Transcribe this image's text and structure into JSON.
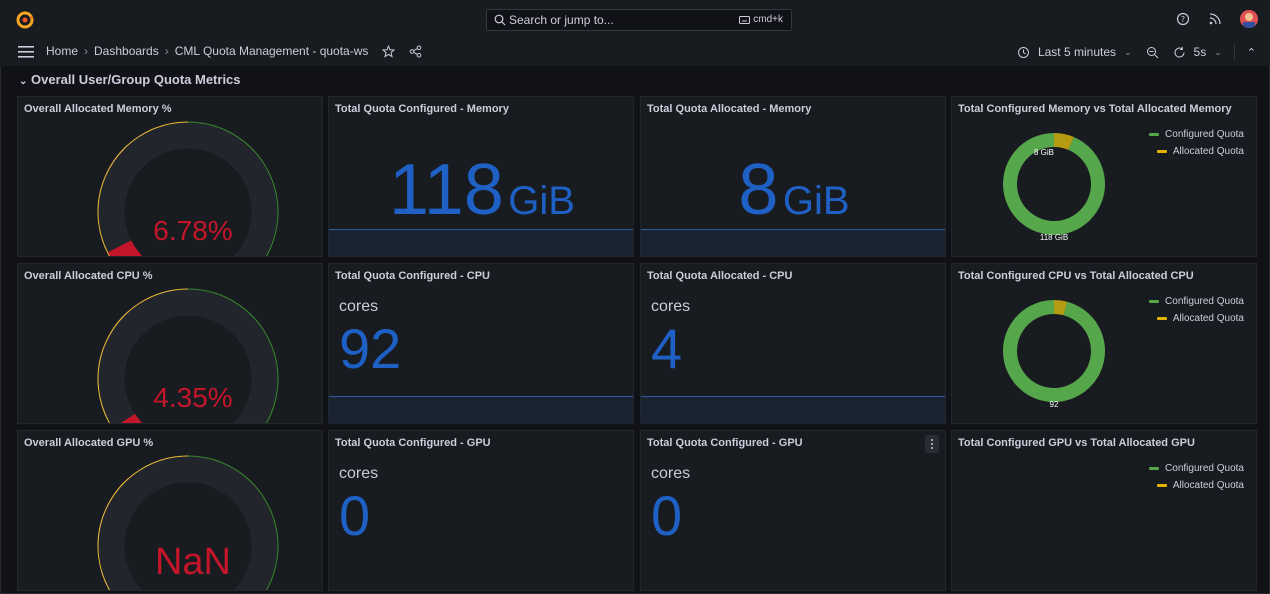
{
  "topbar": {
    "search_placeholder": "Search or jump to...",
    "shortcut": "cmd+k"
  },
  "breadcrumb": {
    "home": "Home",
    "dashboards": "Dashboards",
    "current": "CML Quota Management - quota-ws"
  },
  "time": {
    "range": "Last 5 minutes",
    "refresh": "5s"
  },
  "row": {
    "title": "Overall User/Group Quota Metrics"
  },
  "colors": {
    "gauge_red": "#c4162a",
    "gauge_yellow": "#eab839",
    "gauge_green": "#37872d",
    "stat_blue": "#1f60c4",
    "pie_green": "#56a64b",
    "pie_yellow": "#b59b12"
  },
  "gauges": [
    {
      "title": "Overall Allocated Memory %",
      "value_text": "6.78%",
      "fraction": 0.0678
    },
    {
      "title": "Overall Allocated CPU %",
      "value_text": "4.35%",
      "fraction": 0.0435
    },
    {
      "title": "Overall Allocated GPU %",
      "value_text": "NaN",
      "fraction": 0
    }
  ],
  "stats": [
    {
      "title": "Total Quota Configured - Memory",
      "value": "118",
      "unit": "GiB"
    },
    {
      "title": "Total Quota Allocated - Memory",
      "value": "8",
      "unit": "GiB"
    },
    {
      "title": "Total Quota Configured - CPU",
      "unit": "cores",
      "value": "92"
    },
    {
      "title": "Total Quota Allocated - CPU",
      "unit": "cores",
      "value": "4"
    },
    {
      "title": "Total Quota Configured - GPU",
      "unit": "cores",
      "value": "0"
    },
    {
      "title": "Total Quota Configured - GPU",
      "unit": "cores",
      "value": "0"
    }
  ],
  "donuts": [
    {
      "title": "Total Configured Memory vs Total Allocated Memory",
      "configured": 118,
      "allocated": 8,
      "configured_label": "118 GiB",
      "allocated_label": "8 GiB"
    },
    {
      "title": "Total Configured CPU vs Total Allocated CPU",
      "configured": 92,
      "allocated": 4,
      "configured_label": "92",
      "allocated_label": ""
    },
    {
      "title": "Total Configured GPU vs Total Allocated GPU",
      "configured": 0,
      "allocated": 0,
      "configured_label": "",
      "allocated_label": ""
    }
  ],
  "legend": {
    "configured": "Configured Quota",
    "allocated": "Allocated Quota"
  }
}
